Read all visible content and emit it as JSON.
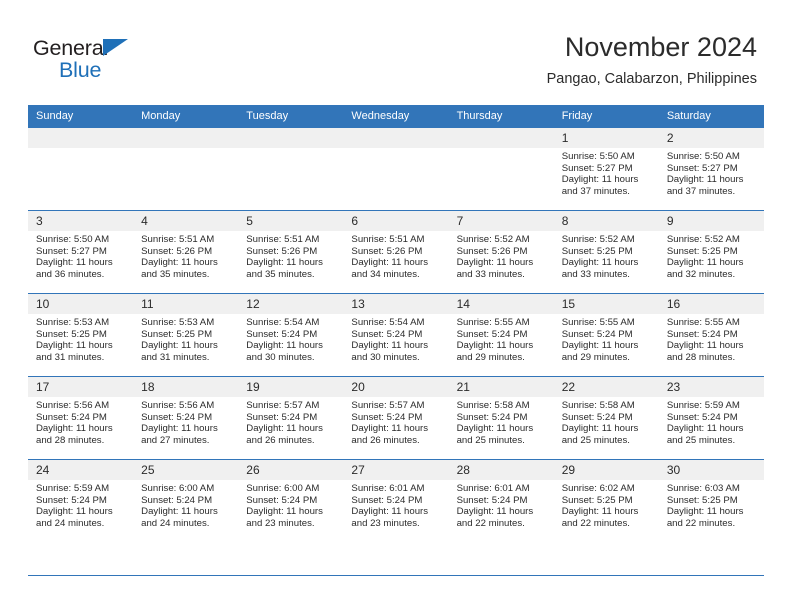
{
  "brand": {
    "name_part1": "General",
    "name_part2": "Blue",
    "accent_color": "#1f70b8"
  },
  "header": {
    "title": "November 2024",
    "subtitle": "Pangao, Calabarzon, Philippines"
  },
  "theme": {
    "header_bg": "#3275b9",
    "daynum_bg": "#f0f0f0",
    "text": "#2b2b2b"
  },
  "weekdays": [
    "Sunday",
    "Monday",
    "Tuesday",
    "Wednesday",
    "Thursday",
    "Friday",
    "Saturday"
  ],
  "weeks": [
    [
      {
        "day": "",
        "empty": true,
        "sunrise": "",
        "sunset": "",
        "daylight1": "",
        "daylight2": ""
      },
      {
        "day": "",
        "empty": true,
        "sunrise": "",
        "sunset": "",
        "daylight1": "",
        "daylight2": ""
      },
      {
        "day": "",
        "empty": true,
        "sunrise": "",
        "sunset": "",
        "daylight1": "",
        "daylight2": ""
      },
      {
        "day": "",
        "empty": true,
        "sunrise": "",
        "sunset": "",
        "daylight1": "",
        "daylight2": ""
      },
      {
        "day": "",
        "empty": true,
        "sunrise": "",
        "sunset": "",
        "daylight1": "",
        "daylight2": ""
      },
      {
        "day": "1",
        "empty": false,
        "sunrise": "Sunrise: 5:50 AM",
        "sunset": "Sunset: 5:27 PM",
        "daylight1": "Daylight: 11 hours",
        "daylight2": "and 37 minutes."
      },
      {
        "day": "2",
        "empty": false,
        "sunrise": "Sunrise: 5:50 AM",
        "sunset": "Sunset: 5:27 PM",
        "daylight1": "Daylight: 11 hours",
        "daylight2": "and 37 minutes."
      }
    ],
    [
      {
        "day": "3",
        "empty": false,
        "sunrise": "Sunrise: 5:50 AM",
        "sunset": "Sunset: 5:27 PM",
        "daylight1": "Daylight: 11 hours",
        "daylight2": "and 36 minutes."
      },
      {
        "day": "4",
        "empty": false,
        "sunrise": "Sunrise: 5:51 AM",
        "sunset": "Sunset: 5:26 PM",
        "daylight1": "Daylight: 11 hours",
        "daylight2": "and 35 minutes."
      },
      {
        "day": "5",
        "empty": false,
        "sunrise": "Sunrise: 5:51 AM",
        "sunset": "Sunset: 5:26 PM",
        "daylight1": "Daylight: 11 hours",
        "daylight2": "and 35 minutes."
      },
      {
        "day": "6",
        "empty": false,
        "sunrise": "Sunrise: 5:51 AM",
        "sunset": "Sunset: 5:26 PM",
        "daylight1": "Daylight: 11 hours",
        "daylight2": "and 34 minutes."
      },
      {
        "day": "7",
        "empty": false,
        "sunrise": "Sunrise: 5:52 AM",
        "sunset": "Sunset: 5:26 PM",
        "daylight1": "Daylight: 11 hours",
        "daylight2": "and 33 minutes."
      },
      {
        "day": "8",
        "empty": false,
        "sunrise": "Sunrise: 5:52 AM",
        "sunset": "Sunset: 5:25 PM",
        "daylight1": "Daylight: 11 hours",
        "daylight2": "and 33 minutes."
      },
      {
        "day": "9",
        "empty": false,
        "sunrise": "Sunrise: 5:52 AM",
        "sunset": "Sunset: 5:25 PM",
        "daylight1": "Daylight: 11 hours",
        "daylight2": "and 32 minutes."
      }
    ],
    [
      {
        "day": "10",
        "empty": false,
        "sunrise": "Sunrise: 5:53 AM",
        "sunset": "Sunset: 5:25 PM",
        "daylight1": "Daylight: 11 hours",
        "daylight2": "and 31 minutes."
      },
      {
        "day": "11",
        "empty": false,
        "sunrise": "Sunrise: 5:53 AM",
        "sunset": "Sunset: 5:25 PM",
        "daylight1": "Daylight: 11 hours",
        "daylight2": "and 31 minutes."
      },
      {
        "day": "12",
        "empty": false,
        "sunrise": "Sunrise: 5:54 AM",
        "sunset": "Sunset: 5:24 PM",
        "daylight1": "Daylight: 11 hours",
        "daylight2": "and 30 minutes."
      },
      {
        "day": "13",
        "empty": false,
        "sunrise": "Sunrise: 5:54 AM",
        "sunset": "Sunset: 5:24 PM",
        "daylight1": "Daylight: 11 hours",
        "daylight2": "and 30 minutes."
      },
      {
        "day": "14",
        "empty": false,
        "sunrise": "Sunrise: 5:55 AM",
        "sunset": "Sunset: 5:24 PM",
        "daylight1": "Daylight: 11 hours",
        "daylight2": "and 29 minutes."
      },
      {
        "day": "15",
        "empty": false,
        "sunrise": "Sunrise: 5:55 AM",
        "sunset": "Sunset: 5:24 PM",
        "daylight1": "Daylight: 11 hours",
        "daylight2": "and 29 minutes."
      },
      {
        "day": "16",
        "empty": false,
        "sunrise": "Sunrise: 5:55 AM",
        "sunset": "Sunset: 5:24 PM",
        "daylight1": "Daylight: 11 hours",
        "daylight2": "and 28 minutes."
      }
    ],
    [
      {
        "day": "17",
        "empty": false,
        "sunrise": "Sunrise: 5:56 AM",
        "sunset": "Sunset: 5:24 PM",
        "daylight1": "Daylight: 11 hours",
        "daylight2": "and 28 minutes."
      },
      {
        "day": "18",
        "empty": false,
        "sunrise": "Sunrise: 5:56 AM",
        "sunset": "Sunset: 5:24 PM",
        "daylight1": "Daylight: 11 hours",
        "daylight2": "and 27 minutes."
      },
      {
        "day": "19",
        "empty": false,
        "sunrise": "Sunrise: 5:57 AM",
        "sunset": "Sunset: 5:24 PM",
        "daylight1": "Daylight: 11 hours",
        "daylight2": "and 26 minutes."
      },
      {
        "day": "20",
        "empty": false,
        "sunrise": "Sunrise: 5:57 AM",
        "sunset": "Sunset: 5:24 PM",
        "daylight1": "Daylight: 11 hours",
        "daylight2": "and 26 minutes."
      },
      {
        "day": "21",
        "empty": false,
        "sunrise": "Sunrise: 5:58 AM",
        "sunset": "Sunset: 5:24 PM",
        "daylight1": "Daylight: 11 hours",
        "daylight2": "and 25 minutes."
      },
      {
        "day": "22",
        "empty": false,
        "sunrise": "Sunrise: 5:58 AM",
        "sunset": "Sunset: 5:24 PM",
        "daylight1": "Daylight: 11 hours",
        "daylight2": "and 25 minutes."
      },
      {
        "day": "23",
        "empty": false,
        "sunrise": "Sunrise: 5:59 AM",
        "sunset": "Sunset: 5:24 PM",
        "daylight1": "Daylight: 11 hours",
        "daylight2": "and 25 minutes."
      }
    ],
    [
      {
        "day": "24",
        "empty": false,
        "sunrise": "Sunrise: 5:59 AM",
        "sunset": "Sunset: 5:24 PM",
        "daylight1": "Daylight: 11 hours",
        "daylight2": "and 24 minutes."
      },
      {
        "day": "25",
        "empty": false,
        "sunrise": "Sunrise: 6:00 AM",
        "sunset": "Sunset: 5:24 PM",
        "daylight1": "Daylight: 11 hours",
        "daylight2": "and 24 minutes."
      },
      {
        "day": "26",
        "empty": false,
        "sunrise": "Sunrise: 6:00 AM",
        "sunset": "Sunset: 5:24 PM",
        "daylight1": "Daylight: 11 hours",
        "daylight2": "and 23 minutes."
      },
      {
        "day": "27",
        "empty": false,
        "sunrise": "Sunrise: 6:01 AM",
        "sunset": "Sunset: 5:24 PM",
        "daylight1": "Daylight: 11 hours",
        "daylight2": "and 23 minutes."
      },
      {
        "day": "28",
        "empty": false,
        "sunrise": "Sunrise: 6:01 AM",
        "sunset": "Sunset: 5:24 PM",
        "daylight1": "Daylight: 11 hours",
        "daylight2": "and 22 minutes."
      },
      {
        "day": "29",
        "empty": false,
        "sunrise": "Sunrise: 6:02 AM",
        "sunset": "Sunset: 5:25 PM",
        "daylight1": "Daylight: 11 hours",
        "daylight2": "and 22 minutes."
      },
      {
        "day": "30",
        "empty": false,
        "sunrise": "Sunrise: 6:03 AM",
        "sunset": "Sunset: 5:25 PM",
        "daylight1": "Daylight: 11 hours",
        "daylight2": "and 22 minutes."
      }
    ]
  ]
}
